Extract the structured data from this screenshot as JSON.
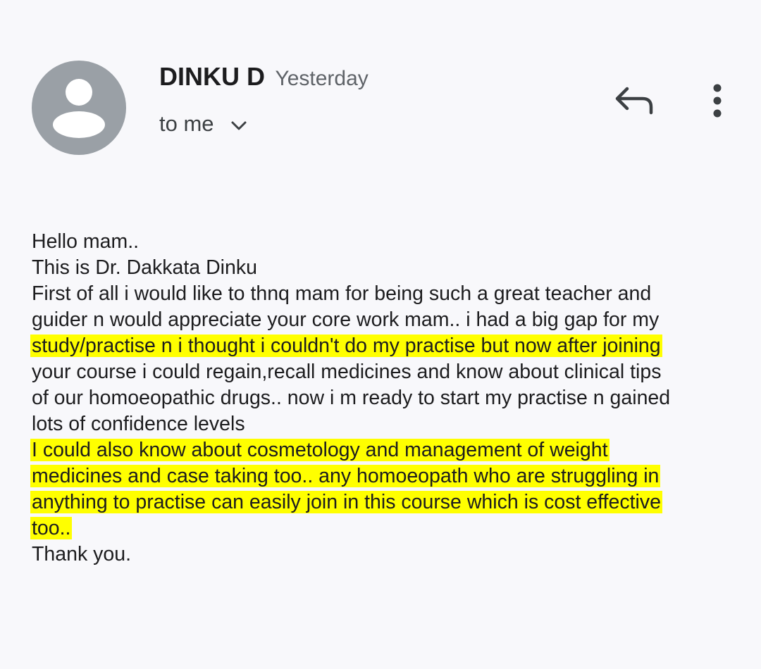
{
  "header": {
    "sender_name": "DINKU D",
    "time": "Yesterday",
    "recipient_label": "to me"
  },
  "icons": {
    "avatar": "person-avatar-icon",
    "expand": "chevron-down-icon",
    "reply": "reply-arrow-icon",
    "more": "more-vert-icon"
  },
  "colors": {
    "highlight": "#ffff00",
    "avatar_bg": "#9aa0a6",
    "background": "#f8f8fb"
  },
  "message": {
    "lines": [
      "Hello mam..",
      "This is Dr. Dakkata Dinku",
      "First of all i would like to thnq mam for being such a great teacher and",
      "guider n would appreciate your core work mam.. i had a big gap for my",
      "study/practise n i thought i couldn't do my practise but now after joining",
      "your course i could regain,recall  medicines and know about clinical tips",
      "of our homoeopathic drugs.. now i m ready to start my practise n gained",
      "lots of confidence levels",
      "I could also know about cosmetology and management of weight",
      "medicines and case taking too.. any homoeopath who are struggling in",
      "anything to practise can easily join in this course which is cost effective",
      "too..",
      "Thank you."
    ],
    "highlighted_lines": [
      4,
      8,
      9,
      10,
      11
    ]
  }
}
